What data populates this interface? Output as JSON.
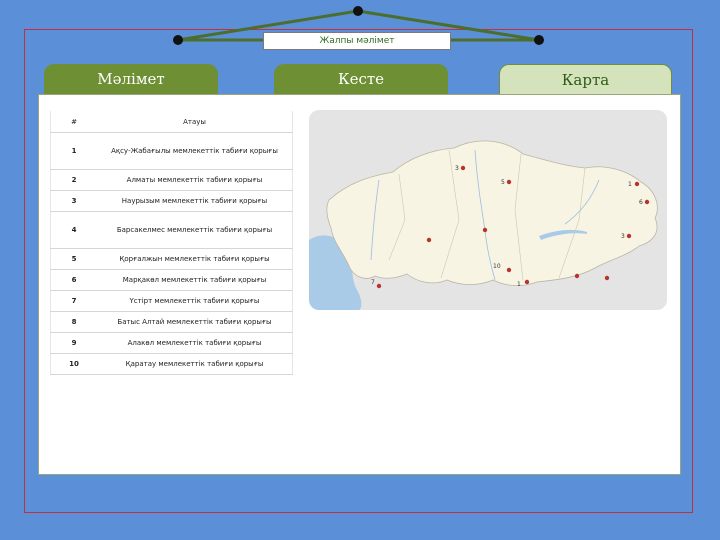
{
  "header": {
    "title": "Жалпы мәлімет"
  },
  "tabs": [
    {
      "label": "Мәлімет",
      "active": false
    },
    {
      "label": "Кесте",
      "active": false
    },
    {
      "label": "Карта",
      "active": true
    }
  ],
  "table": {
    "headers": [
      "#",
      "Атауы"
    ],
    "rows": [
      {
        "num": "1",
        "name": "Ақсу-Жабағылы мемлекеттік табиғи қорығы"
      },
      {
        "num": "2",
        "name": "Алматы мемлекеттік табиғи қорығы"
      },
      {
        "num": "3",
        "name": "Наурызым мемлекеттік табиғи қорығы"
      },
      {
        "num": "4",
        "name": "Барсакелмес мемлекеттік табиғи қорығы"
      },
      {
        "num": "5",
        "name": "Қорғалжын мемлекеттік табиғи қорығы"
      },
      {
        "num": "6",
        "name": "Марқакөл мемлекеттік табиғи қорығы"
      },
      {
        "num": "7",
        "name": "Үстірт мемлекеттік табиғи қорығы"
      },
      {
        "num": "8",
        "name": "Батыс Алтай мемлекеттік табиғи қорығы"
      },
      {
        "num": "9",
        "name": "Алакөл мемлекеттік табиғи қорығы"
      },
      {
        "num": "10",
        "name": "Қаратау мемлекеттік табиғи қорығы"
      }
    ]
  },
  "map": {
    "markers": [
      "1",
      "2",
      "3",
      "5",
      "6",
      "7",
      "8",
      "10"
    ],
    "colors": {
      "land": "#f7f4e4",
      "neighbors": "#e4e4e4",
      "water": "#a9cbe8",
      "marker": "#b8332c"
    }
  },
  "colors": {
    "background": "#5b8fd8",
    "tab": "#6e8f33",
    "active_tab": "#d4e3bc",
    "frame": "#c0313b"
  }
}
